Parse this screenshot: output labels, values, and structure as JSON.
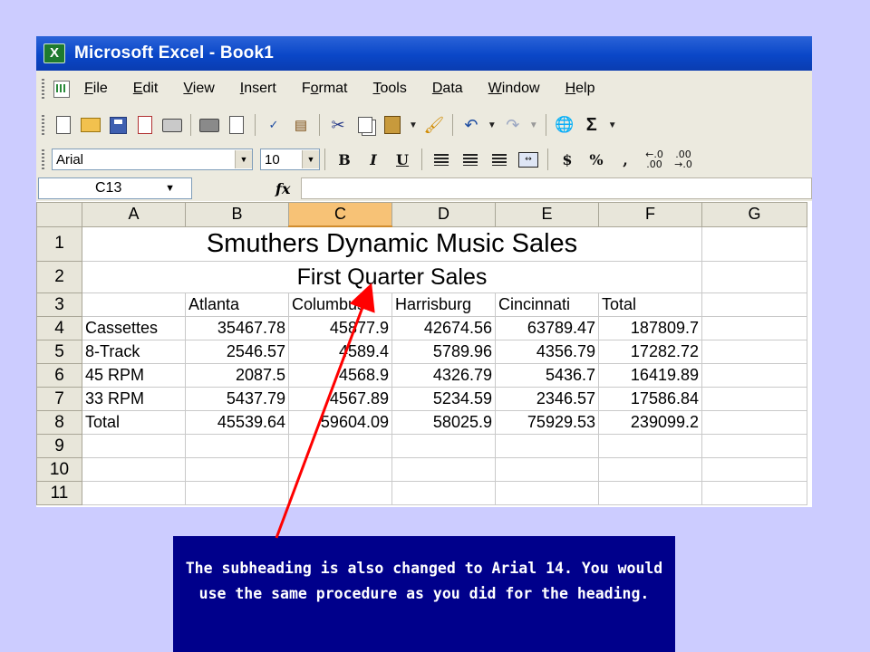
{
  "window": {
    "title": "Microsoft Excel - Book1"
  },
  "menu": [
    {
      "label": "File",
      "key": "F",
      "rest": "ile"
    },
    {
      "label": "Edit",
      "key": "E",
      "rest": "dit"
    },
    {
      "label": "View",
      "key": "V",
      "rest": "iew"
    },
    {
      "label": "Insert",
      "key": "I",
      "rest": "nsert"
    },
    {
      "label": "Format",
      "pre": "F",
      "key": "o",
      "rest": "rmat"
    },
    {
      "label": "Tools",
      "key": "T",
      "rest": "ools"
    },
    {
      "label": "Data",
      "key": "D",
      "rest": "ata"
    },
    {
      "label": "Window",
      "key": "W",
      "rest": "indow"
    },
    {
      "label": "Help",
      "key": "H",
      "rest": "elp"
    }
  ],
  "format_toolbar": {
    "font_name": "Arial",
    "font_size": "10",
    "bold": "B",
    "italic": "I",
    "underline": "U",
    "currency": "$",
    "percent": "%",
    "comma": ","
  },
  "standard_toolbar": {
    "sum": "Σ"
  },
  "formula_bar": {
    "name_box": "C13",
    "fx": "fx",
    "formula": ""
  },
  "sheet": {
    "columns": [
      "A",
      "B",
      "C",
      "D",
      "E",
      "F",
      "G"
    ],
    "selected_column": "C",
    "rows": [
      {
        "n": "1",
        "title": "Smuthers Dynamic Music Sales"
      },
      {
        "n": "2",
        "title": "First Quarter Sales"
      },
      {
        "n": "3",
        "cells": [
          "",
          "Atlanta",
          "Columbus",
          "Harrisburg",
          "Cincinnati",
          "Total",
          ""
        ]
      },
      {
        "n": "4",
        "cells": [
          "Cassettes",
          "35467.78",
          "45877.9",
          "42674.56",
          "63789.47",
          "187809.7",
          ""
        ]
      },
      {
        "n": "5",
        "cells": [
          "8-Track",
          "2546.57",
          "4589.4",
          "5789.96",
          "4356.79",
          "17282.72",
          ""
        ]
      },
      {
        "n": "6",
        "cells": [
          "45 RPM",
          "2087.5",
          "4568.9",
          "4326.79",
          "5436.7",
          "16419.89",
          ""
        ]
      },
      {
        "n": "7",
        "cells": [
          "33 RPM",
          "5437.79",
          "4567.89",
          "5234.59",
          "2346.57",
          "17586.84",
          ""
        ]
      },
      {
        "n": "8",
        "cells": [
          "Total",
          "45539.64",
          "59604.09",
          "58025.9",
          "75929.53",
          "239099.2",
          ""
        ]
      },
      {
        "n": "9",
        "cells": [
          "",
          "",
          "",
          "",
          "",
          "",
          ""
        ]
      },
      {
        "n": "10",
        "cells": [
          "",
          "",
          "",
          "",
          "",
          "",
          ""
        ]
      },
      {
        "n": "11",
        "cells": [
          "",
          "",
          "",
          "",
          "",
          "",
          ""
        ]
      }
    ]
  },
  "callout": {
    "text": "The subheading is also changed to Arial 14. You would use the same procedure as you did for the heading.",
    "background": "#00008b",
    "arrow_color": "#ff0000"
  }
}
